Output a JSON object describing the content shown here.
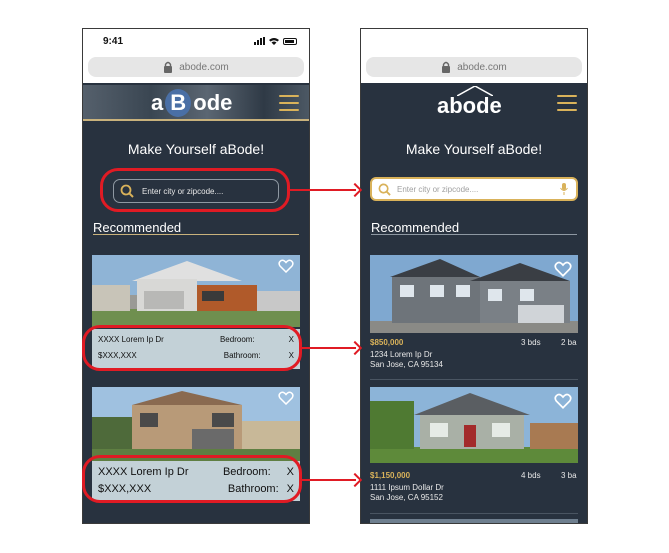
{
  "status": {
    "time": "9:41"
  },
  "browser": {
    "url": "abode.com"
  },
  "left_phone": {
    "logo_a": "a",
    "logo_b": "B",
    "logo_rest": "ode",
    "tagline": "Make Yourself aBode!",
    "search_placeholder": "Enter city or zipcode....",
    "section_title": "Recommended",
    "listings": [
      {
        "address": "XXXX Lorem Ip Dr",
        "price": "$XXX,XXX",
        "bedroom_label": "Bedroom:",
        "bedroom_value": "X",
        "bathroom_label": "Bathroom:",
        "bathroom_value": "X"
      },
      {
        "address": "XXXX Lorem Ip Dr",
        "price": "$XXX,XXX",
        "bedroom_label": "Bedroom:",
        "bedroom_value": "X",
        "bathroom_label": "Bathroom:",
        "bathroom_value": "X"
      }
    ]
  },
  "right_phone": {
    "logo": "abode",
    "tagline": "Make Yourself aBode!",
    "search_placeholder": "Enter city or zipcode....",
    "section_title": "Recommended",
    "listings": [
      {
        "price": "$850,000",
        "beds": "3 bds",
        "baths": "2 ba",
        "street": "1234 Lorem Ip Dr",
        "city": "San Jose, CA 95134"
      },
      {
        "price": "$1,150,000",
        "beds": "4 bds",
        "baths": "3 ba",
        "street": "1111 Ipsum Dollar Dr",
        "city": "San Jose, CA 95152"
      }
    ]
  },
  "colors": {
    "app_bg": "#28323f",
    "accent_gold": "#d9b25a",
    "callout_red": "#e01b24",
    "info_panel": "#c3d1d7"
  }
}
